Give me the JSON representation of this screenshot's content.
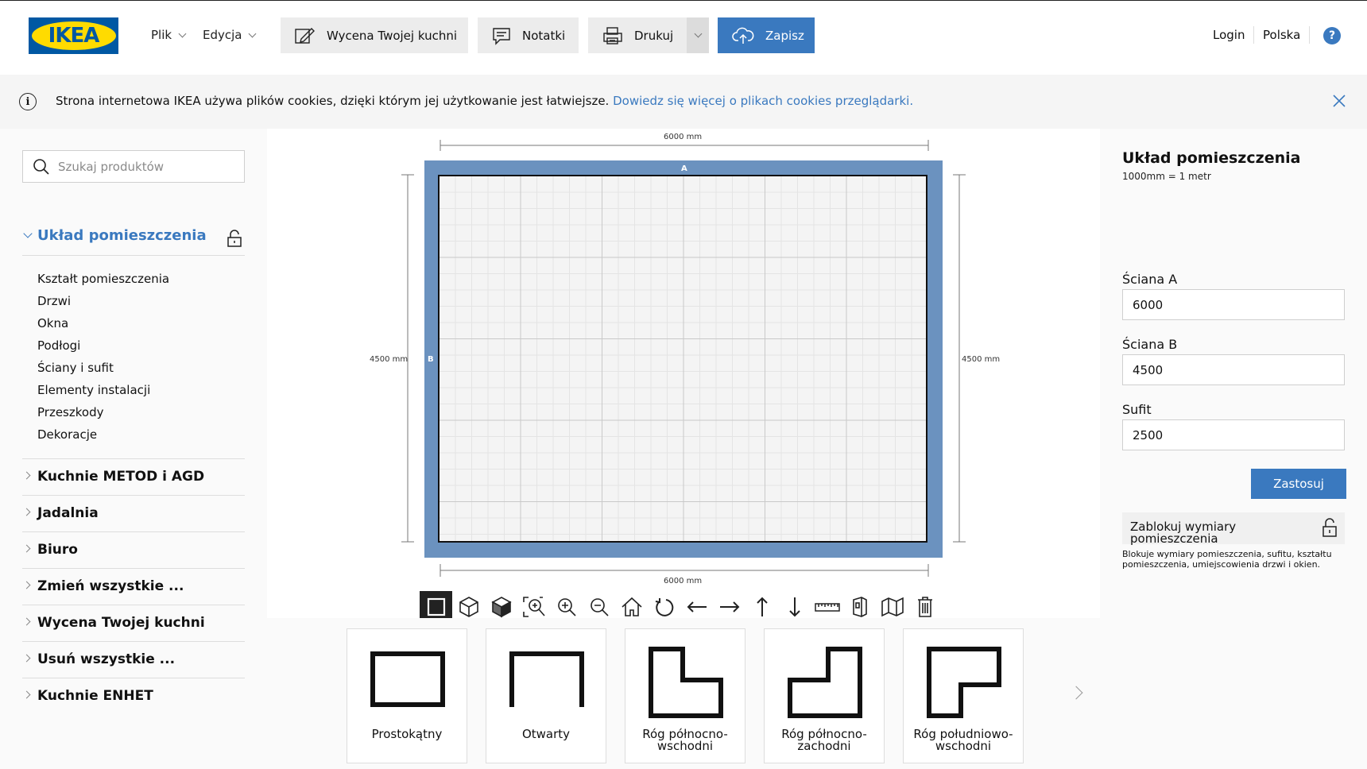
{
  "header": {
    "logo_text": "IKEA",
    "menu": {
      "file": "Plik",
      "edit": "Edycja"
    },
    "buttons": {
      "quote": "Wycena Twojej kuchni",
      "notes": "Notatki",
      "print": "Drukuj",
      "save": "Zapisz"
    },
    "login": "Login",
    "country": "Polska",
    "help": "?"
  },
  "cookie": {
    "text": "Strona internetowa IKEA używa plików cookies, dzięki którym jej użytkowanie jest łatwiejsze.",
    "link": "Dowiedz się więcej o plikach cookies przeglądarki."
  },
  "sidebar": {
    "search_placeholder": "Szukaj produktów",
    "section_title": "Układ pomieszczenia",
    "sub_items": [
      "Kształt pomieszczenia",
      "Drzwi",
      "Okna",
      "Podłogi",
      "Ściany i sufit",
      "Elementy instalacji",
      "Przeszkody",
      "Dekoracje"
    ],
    "categories": [
      "Kuchnie METOD i AGD",
      "Jadalnia",
      "Biuro",
      "Zmień wszystkie ...",
      "Wycena Twojej kuchni",
      "Usuń wszystkie ...",
      "Kuchnie ENHET"
    ]
  },
  "canvas": {
    "dim_top": "6000 mm",
    "dim_bottom": "6000 mm",
    "dim_left": "4500 mm",
    "dim_right": "4500 mm",
    "wall_a": "A",
    "wall_b": "B"
  },
  "toolbar": {
    "tools": [
      "square-view-icon",
      "cube-outline-icon",
      "cube-solid-icon",
      "zoom-fit-icon",
      "zoom-in-icon",
      "zoom-out-icon",
      "home-icon",
      "rotate-icon",
      "arrow-left-icon",
      "arrow-right-icon",
      "arrow-up-icon",
      "arrow-down-icon",
      "ruler-icon",
      "wall-view-icon",
      "floor-map-icon",
      "trash-icon"
    ],
    "active": "square-view-icon"
  },
  "shapes": [
    {
      "label": "Prostokątny"
    },
    {
      "label": "Otwarty"
    },
    {
      "label": "Róg północno-wschodni"
    },
    {
      "label": "Róg północno-zachodni"
    },
    {
      "label": "Róg południowo-wschodni"
    }
  ],
  "panel": {
    "title": "Układ pomieszczenia",
    "scale": "1000mm = 1 metr",
    "wall_a_label": "Ściana A",
    "wall_a_value": "6000",
    "wall_b_label": "Ściana B",
    "wall_b_value": "4500",
    "ceiling_label": "Sufit",
    "ceiling_value": "2500",
    "apply": "Zastosuj",
    "lock_label": "Zablokuj wymiary pomieszczenia",
    "lock_desc": "Blokuje wymiary pomieszczenia, sufitu, kształtu pomieszczenia, umiejscowienia drzwi i okien."
  },
  "colors": {
    "accent": "#3a79bf",
    "wall": "#6b92bf",
    "logo_blue": "#0058a3",
    "logo_yellow": "#ffdb00"
  }
}
